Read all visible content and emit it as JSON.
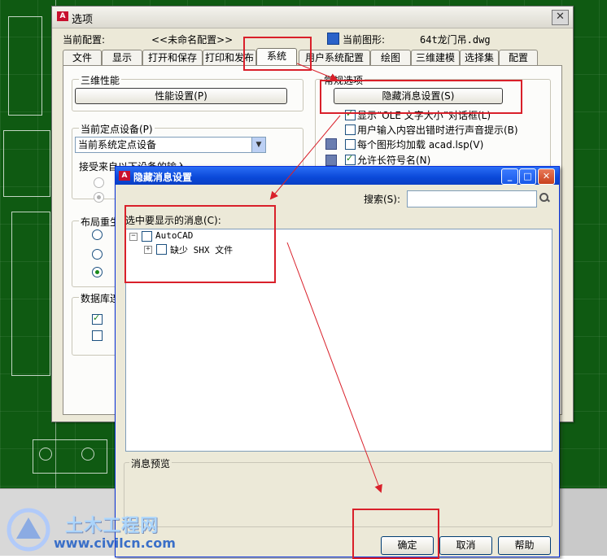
{
  "colors": {
    "annotation_red": "#d9202a",
    "cad_bg": "#0f5a12",
    "xp_blue": "#0a48d8",
    "dialog_face": "#ece9d8"
  },
  "options_dialog": {
    "title": "选项",
    "current_config_label": "当前配置:",
    "current_config_value": "<<未命名配置>>",
    "current_drawing_label": "当前图形:",
    "current_drawing_value": "64t龙门吊.dwg",
    "tabs": [
      "文件",
      "显示",
      "打开和保存",
      "打印和发布",
      "系统",
      "用户系统配置",
      "绘图",
      "三维建模",
      "选择集",
      "配置"
    ],
    "active_tab": "系统",
    "perf_group": "三维性能",
    "perf_button": "性能设置(P)",
    "pointing_group": "当前定点设备(P)",
    "pointing_select": "当前系统定点设备",
    "accept_input_label": "接受来自以下设备的输入",
    "layout_regen_group": "布局重生",
    "db_group": "数据库连",
    "general_group": "常规选项",
    "hidden_msg_button": "隐藏消息设置(S)",
    "general_checks": [
      {
        "label": "显示“OLE 文字大小”对话框(L)",
        "checked": true
      },
      {
        "label": "用户输入内容出错时进行声音提示(B)",
        "checked": false
      },
      {
        "label": "每个图形均加载 acad.lsp(V)",
        "checked": false
      },
      {
        "label": "允许长符号名(N)",
        "checked": true
      }
    ]
  },
  "hide_dialog": {
    "title": "隐藏消息设置",
    "search_label": "搜索(S):",
    "search_value": "",
    "select_label": "选中要显示的消息(C):",
    "tree": [
      {
        "label": "AutoCAD",
        "checked": false,
        "expander": "−"
      },
      {
        "label": "缺少 SHX 文件",
        "checked": false,
        "expander": "+"
      }
    ],
    "preview_label": "消息预览",
    "ok_button": "确定",
    "cancel_button": "取消",
    "help_button": "帮助"
  },
  "icons": {
    "app": "autocad-logo-icon",
    "search": "magnifier-icon",
    "close": "close-icon",
    "minimize": "minimize-icon",
    "maximize": "maximize-icon"
  },
  "watermark": {
    "name": "土木工程网",
    "url": "www.civilcn.com"
  }
}
